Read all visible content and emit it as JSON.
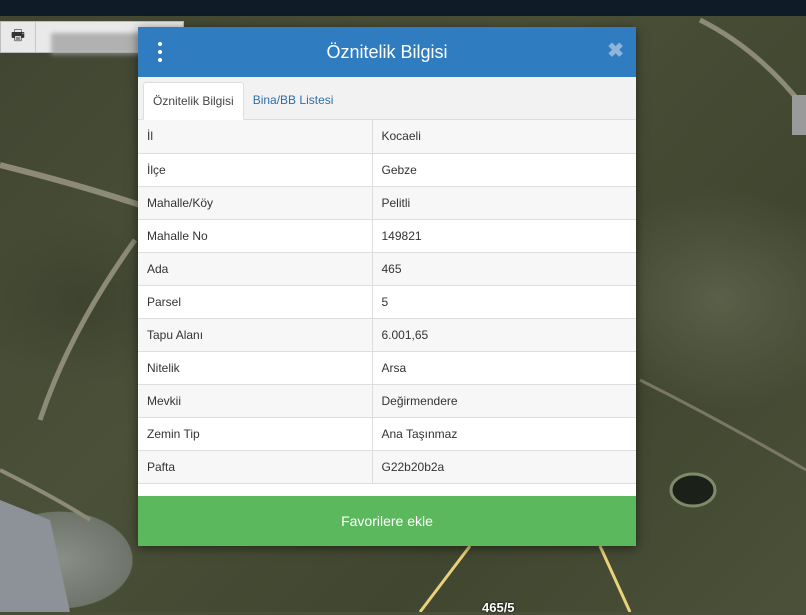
{
  "toolbar": {
    "print_icon": "print-icon",
    "print_glyph": "🖶"
  },
  "map": {
    "parcel_label": "465/5"
  },
  "dialog": {
    "title": "Öznitelik Bilgisi",
    "menu_icon": "vertical-dots-icon",
    "close_glyph": "✖",
    "tabs": [
      {
        "label": "Öznitelik Bilgisi",
        "active": true
      },
      {
        "label": "Bina/BB Listesi",
        "active": false
      }
    ],
    "rows": [
      {
        "key": "İl",
        "value": "Kocaeli"
      },
      {
        "key": "İlçe",
        "value": "Gebze"
      },
      {
        "key": "Mahalle/Köy",
        "value": "Pelitli"
      },
      {
        "key": "Mahalle No",
        "value": "149821"
      },
      {
        "key": "Ada",
        "value": "465"
      },
      {
        "key": "Parsel",
        "value": "5"
      },
      {
        "key": "Tapu Alanı",
        "value": "6.001,65"
      },
      {
        "key": "Nitelik",
        "value": "Arsa"
      },
      {
        "key": "Mevkii",
        "value": "Değirmendere"
      },
      {
        "key": "Zemin Tip",
        "value": "Ana Taşınmaz"
      },
      {
        "key": "Pafta",
        "value": "G22b20b2a"
      }
    ],
    "favorite_button": "Favorilere ekle"
  },
  "colors": {
    "header": "#2f7cc1",
    "button": "#5cb85c",
    "tab_link": "#2f6fa8"
  }
}
